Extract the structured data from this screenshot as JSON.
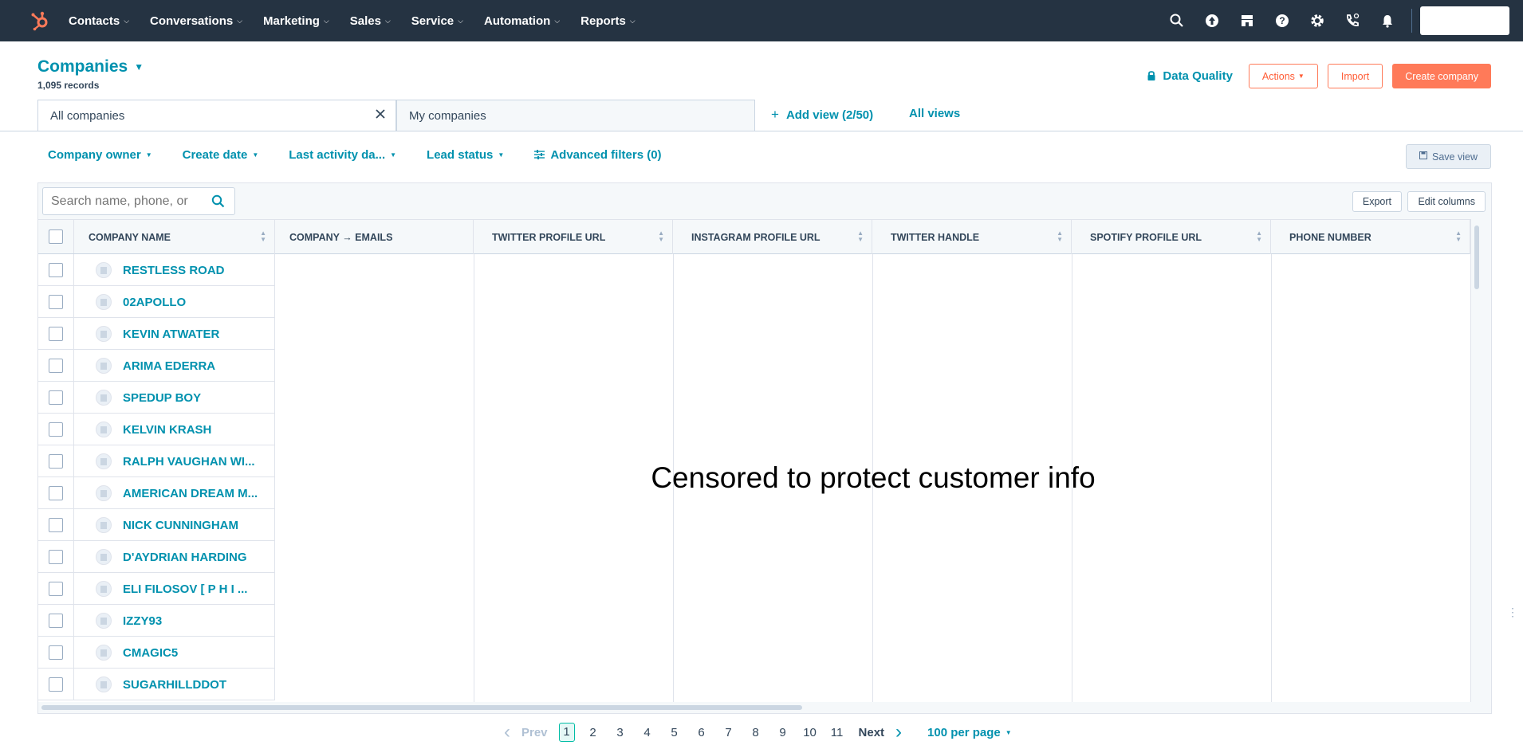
{
  "topnav": {
    "items": [
      {
        "label": "Contacts"
      },
      {
        "label": "Conversations"
      },
      {
        "label": "Marketing"
      },
      {
        "label": "Sales"
      },
      {
        "label": "Service"
      },
      {
        "label": "Automation"
      },
      {
        "label": "Reports"
      }
    ],
    "icons": [
      "search-icon",
      "upgrade-icon",
      "marketplace-icon",
      "help-icon",
      "settings-icon",
      "calling-icon",
      "notifications-icon"
    ],
    "bg_color": "#253342",
    "logo_color": "#ff7a59"
  },
  "header": {
    "title": "Companies",
    "records": "1,095 records",
    "data_quality": "Data Quality",
    "actions": "Actions",
    "import": "Import",
    "create": "Create company"
  },
  "tabs": {
    "active": "All companies",
    "inactive": "My companies",
    "add_view": "Add view (2/50)",
    "all_views": "All views"
  },
  "filters": {
    "company_owner": "Company owner",
    "create_date": "Create date",
    "last_activity": "Last activity da...",
    "lead_status": "Lead status",
    "advanced": "Advanced filters (0)",
    "save_view": "Save view"
  },
  "table": {
    "search_placeholder": "Search name, phone, or",
    "export": "Export",
    "edit_columns": "Edit columns",
    "columns": [
      "COMPANY NAME",
      "COMPANY → EMAILS",
      "TWITTER PROFILE URL",
      "INSTAGRAM PROFILE URL",
      "TWITTER HANDLE",
      "SPOTIFY PROFILE URL",
      "PHONE NUMBER"
    ],
    "rows": [
      "RESTLESS ROAD",
      "02APOLLO",
      "KEVIN ATWATER",
      "ARIMA EDERRA",
      "SPEDUP BOY",
      "KELVIN KRASH",
      "RALPH VAUGHAN WI...",
      "AMERICAN DREAM M...",
      "NICK CUNNINGHAM",
      "D'AYDRIAN HARDING",
      "ELI FILOSOV [ P H I ...",
      "IZZY93",
      "CMAGIC5",
      "SUGARHILLDDOT"
    ],
    "censor_text": "Censored to protect customer info"
  },
  "pager": {
    "prev": "Prev",
    "pages": [
      "1",
      "2",
      "3",
      "4",
      "5",
      "6",
      "7",
      "8",
      "9",
      "10",
      "11"
    ],
    "current": "1",
    "next": "Next",
    "per_page": "100 per page"
  },
  "colors": {
    "accent": "#0091ae",
    "brand_orange": "#ff7a59",
    "text": "#33475b"
  }
}
